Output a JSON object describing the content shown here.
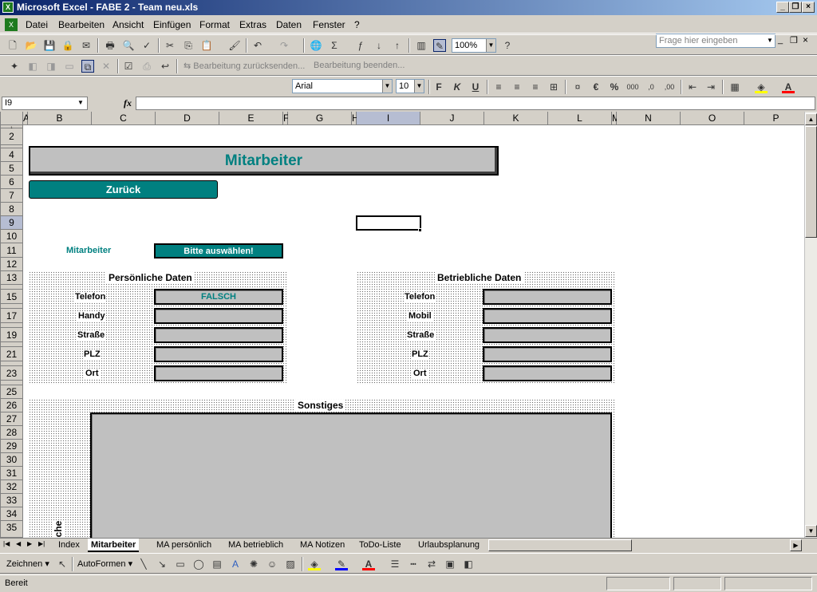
{
  "window": {
    "title": "Microsoft Excel - FABE 2 - Team neu.xls"
  },
  "menu": [
    "Datei",
    "Bearbeiten",
    "Ansicht",
    "Einfügen",
    "Format",
    "Extras",
    "Daten",
    "Fenster",
    "?"
  ],
  "help_placeholder": "Frage hier eingeben",
  "toolbar": {
    "zoom": "100%",
    "review_send": "Bearbeitung zurücksenden...",
    "review_end": "Bearbeitung beenden..."
  },
  "format": {
    "font": "Arial",
    "size": "10"
  },
  "namebox": "I9",
  "fx": "fx",
  "columns": [
    "A",
    "B",
    "C",
    "D",
    "E",
    "F",
    "G",
    "H",
    "I",
    "J",
    "K",
    "L",
    "M",
    "N",
    "O",
    "P"
  ],
  "rows": [
    "1",
    "2",
    "4",
    "5",
    "6",
    "7",
    "8",
    "9",
    "10",
    "11",
    "12",
    "13",
    "14",
    "15",
    "17",
    "19",
    "21",
    "23",
    "25",
    "26",
    "27",
    "28",
    "29",
    "30",
    "31",
    "32",
    "33",
    "34",
    "35"
  ],
  "sheet": {
    "title": "Mitarbeiter",
    "back": "Zurück",
    "mitarbeiter_label": "Mitarbeiter",
    "select_button": "Bitte auswählen!",
    "personal_header": "Persönliche Daten",
    "business_header": "Betriebliche Daten",
    "personal_labels": [
      "Telefon",
      "Handy",
      "Straße",
      "PLZ",
      "Ort"
    ],
    "business_labels": [
      "Telefon",
      "Mobil",
      "Straße",
      "PLZ",
      "Ort"
    ],
    "telefon_value": "FALSCH",
    "misc_header": "Sonstiges",
    "vertical_text": "che"
  },
  "tabs": [
    "Index",
    "Mitarbeiter",
    "MA persönlich",
    "MA betrieblich",
    "MA Notizen",
    "ToDo-Liste",
    "Urlaubsplanung"
  ],
  "drawbar": {
    "draw": "Zeichnen",
    "autoshapes": "AutoFormen"
  },
  "status": "Bereit",
  "colors": {
    "teal": "#008080",
    "title_bar": "#0a246a",
    "field": "#c0c0c0"
  }
}
